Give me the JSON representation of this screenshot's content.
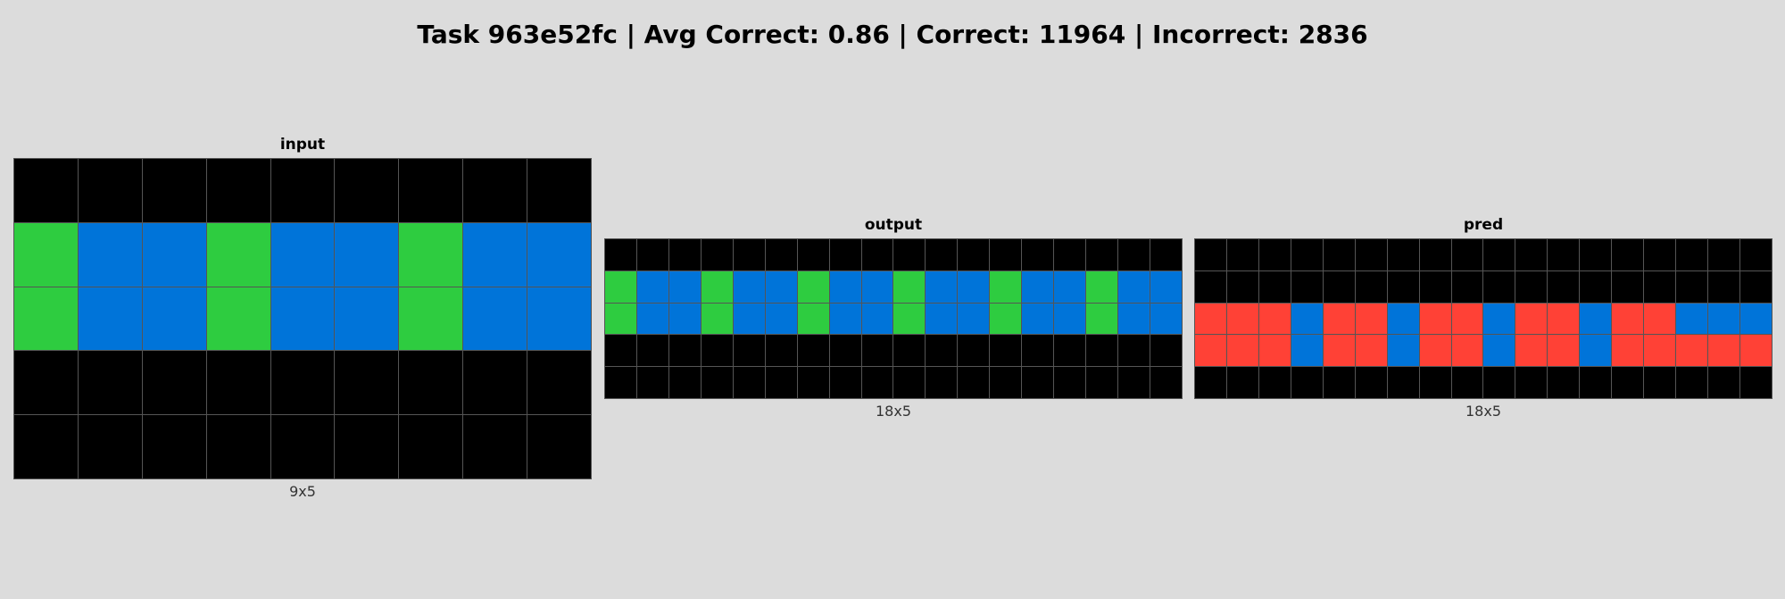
{
  "title": "Task 963e52fc | Avg Correct: 0.86 | Correct: 11964 | Incorrect: 2836",
  "palette": {
    "0": "#000000",
    "1": "#0074d9",
    "2": "#ff4136",
    "3": "#2ecc40"
  },
  "panels": [
    {
      "label": "input",
      "dims": "9x5",
      "rows": [
        [
          0,
          0,
          0,
          0,
          0,
          0,
          0,
          0,
          0
        ],
        [
          3,
          1,
          1,
          3,
          1,
          1,
          3,
          1,
          1
        ],
        [
          3,
          1,
          1,
          3,
          1,
          1,
          3,
          1,
          1
        ],
        [
          0,
          0,
          0,
          0,
          0,
          0,
          0,
          0,
          0
        ],
        [
          0,
          0,
          0,
          0,
          0,
          0,
          0,
          0,
          0
        ]
      ]
    },
    {
      "label": "output",
      "dims": "18x5",
      "rows": [
        [
          0,
          0,
          0,
          0,
          0,
          0,
          0,
          0,
          0,
          0,
          0,
          0,
          0,
          0,
          0,
          0,
          0,
          0
        ],
        [
          3,
          1,
          1,
          3,
          1,
          1,
          3,
          1,
          1,
          3,
          1,
          1,
          3,
          1,
          1,
          3,
          1,
          1
        ],
        [
          3,
          1,
          1,
          3,
          1,
          1,
          3,
          1,
          1,
          3,
          1,
          1,
          3,
          1,
          1,
          3,
          1,
          1
        ],
        [
          0,
          0,
          0,
          0,
          0,
          0,
          0,
          0,
          0,
          0,
          0,
          0,
          0,
          0,
          0,
          0,
          0,
          0
        ],
        [
          0,
          0,
          0,
          0,
          0,
          0,
          0,
          0,
          0,
          0,
          0,
          0,
          0,
          0,
          0,
          0,
          0,
          0
        ]
      ]
    },
    {
      "label": "pred",
      "dims": "18x5",
      "rows": [
        [
          0,
          0,
          0,
          0,
          0,
          0,
          0,
          0,
          0,
          0,
          0,
          0,
          0,
          0,
          0,
          0,
          0,
          0
        ],
        [
          0,
          0,
          0,
          0,
          0,
          0,
          0,
          0,
          0,
          0,
          0,
          0,
          0,
          0,
          0,
          0,
          0,
          0
        ],
        [
          2,
          2,
          2,
          1,
          2,
          2,
          1,
          2,
          2,
          1,
          2,
          2,
          1,
          2,
          2,
          1,
          1,
          1
        ],
        [
          2,
          2,
          2,
          1,
          2,
          2,
          1,
          2,
          2,
          1,
          2,
          2,
          1,
          2,
          2,
          2,
          2,
          2
        ],
        [
          0,
          0,
          0,
          0,
          0,
          0,
          0,
          0,
          0,
          0,
          0,
          0,
          0,
          0,
          0,
          0,
          0,
          0
        ]
      ]
    }
  ]
}
